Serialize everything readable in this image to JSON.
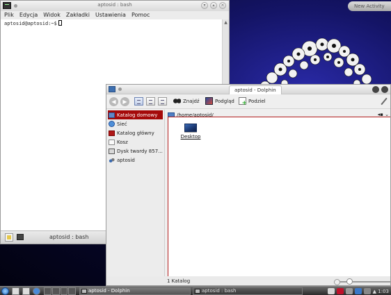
{
  "desktop": {
    "new_activity_label": "New Activity"
  },
  "konsole": {
    "title": "aptosid : bash",
    "menu": [
      "Plik",
      "Edycja",
      "Widok",
      "Zakładki",
      "Ustawienia",
      "Pomoc"
    ],
    "prompt": "aptosid@aptosid:~$",
    "tab_title": "aptosid : bash"
  },
  "dolphin": {
    "title": "aptosid - Dolphin",
    "toolbar": {
      "find_label": "Znajdź",
      "preview_label": "Podgląd",
      "split_label": "Podziel"
    },
    "places": [
      {
        "label": "Katalog domowy",
        "icon": "home-folder-icon",
        "selected": true
      },
      {
        "label": "Sieć",
        "icon": "network-icon"
      },
      {
        "label": "Katalog główny",
        "icon": "root-folder-icon"
      },
      {
        "label": "Kosz",
        "icon": "trash-icon"
      },
      {
        "label": "Dysk twardy 857...",
        "icon": "hard-disk-icon"
      },
      {
        "label": "aptosid",
        "icon": "user-icon"
      }
    ],
    "path": "/home/aptosid/",
    "files": [
      {
        "name": "Desktop",
        "icon": "desktop-folder-icon"
      }
    ],
    "status": "1 Katalog"
  },
  "taskbar": {
    "tasks": [
      {
        "label": "aptosid - Dolphin",
        "active": true
      },
      {
        "label": "aptosid : bash",
        "active": false
      }
    ],
    "clock": "▲ 1:03"
  },
  "colors": {
    "selection": "#a50a0a",
    "wallpaper": "#141466"
  }
}
